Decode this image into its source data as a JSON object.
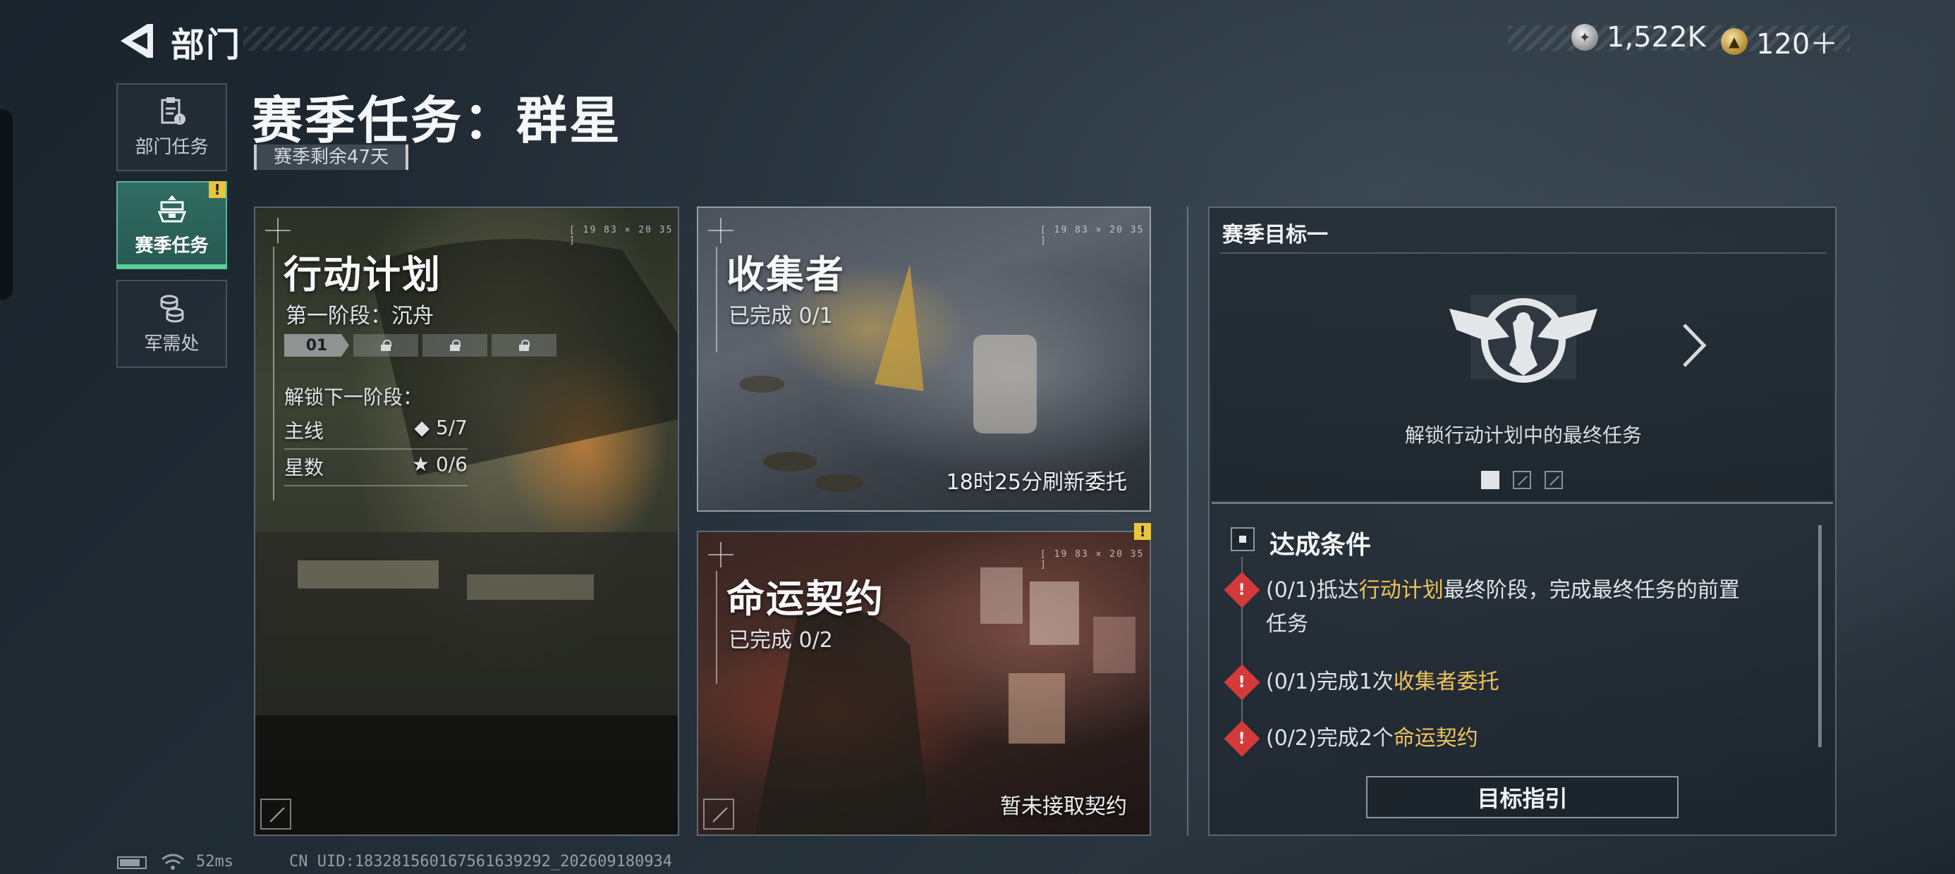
{
  "header": {
    "section_title": "部门",
    "currency": [
      {
        "icon": "silver-coin-icon",
        "value": "1,522K"
      },
      {
        "icon": "gold-coin-icon",
        "value": "120＋"
      }
    ]
  },
  "sidebar": {
    "items": [
      {
        "label": "部门任务",
        "icon": "clipboard-icon",
        "active": false
      },
      {
        "label": "赛季任务",
        "icon": "season-emblem-icon",
        "active": true,
        "badge": "!"
      },
      {
        "label": "军需处",
        "icon": "coins-stack-icon",
        "active": false
      }
    ]
  },
  "page": {
    "title": "赛季任务：群星",
    "season_remaining": "赛季剩余47天"
  },
  "cards": {
    "action_plan": {
      "title": "行动计划",
      "stage": "第一阶段：沉舟",
      "current_stage": "01",
      "unlock_label": "解锁下一阶段：",
      "requirements": [
        {
          "label": "主线",
          "symbol": "◆",
          "value": "5/7"
        },
        {
          "label": "星数",
          "symbol": "★",
          "value": "0/6"
        }
      ],
      "corner": "[ 19 83 × 20 35 ]"
    },
    "collector": {
      "title": "收集者",
      "progress": "已完成 0/1",
      "footer": "18时25分刷新委托",
      "corner": "[ 19 83 × 20 35 ]"
    },
    "fate_contract": {
      "title": "命运契约",
      "progress": "已完成 0/2",
      "footer": "暂未接取契约",
      "badge": "!",
      "corner": "[ 19 83 × 20 35 ]"
    }
  },
  "season_goal": {
    "header": "赛季目标一",
    "emblem_icon": "eagle-emblem-icon",
    "description": "解锁行动计划中的最终任务",
    "pages_total": 3,
    "page_current": 1,
    "conditions_title": "达成条件",
    "conditions": [
      {
        "prefix": "(0/1)抵达",
        "highlight": "行动计划",
        "suffix": "最终阶段，完成最终任务的前置",
        "line2": "任务"
      },
      {
        "prefix": "(0/1)完成1次",
        "highlight": "收集者委托",
        "suffix": ""
      },
      {
        "prefix": "(0/2)完成2个",
        "highlight": "命运契约",
        "suffix": ""
      }
    ],
    "guide_button": "目标指引"
  },
  "status_bar": {
    "ping": "52ms",
    "uid": "CN UID:18328156016756163929​2_202609180934"
  },
  "colors": {
    "accent_green": "#56d39a",
    "highlight_gold": "#efc35a",
    "warning_red": "#d53a3a",
    "badge_yellow": "#e8c53c"
  }
}
